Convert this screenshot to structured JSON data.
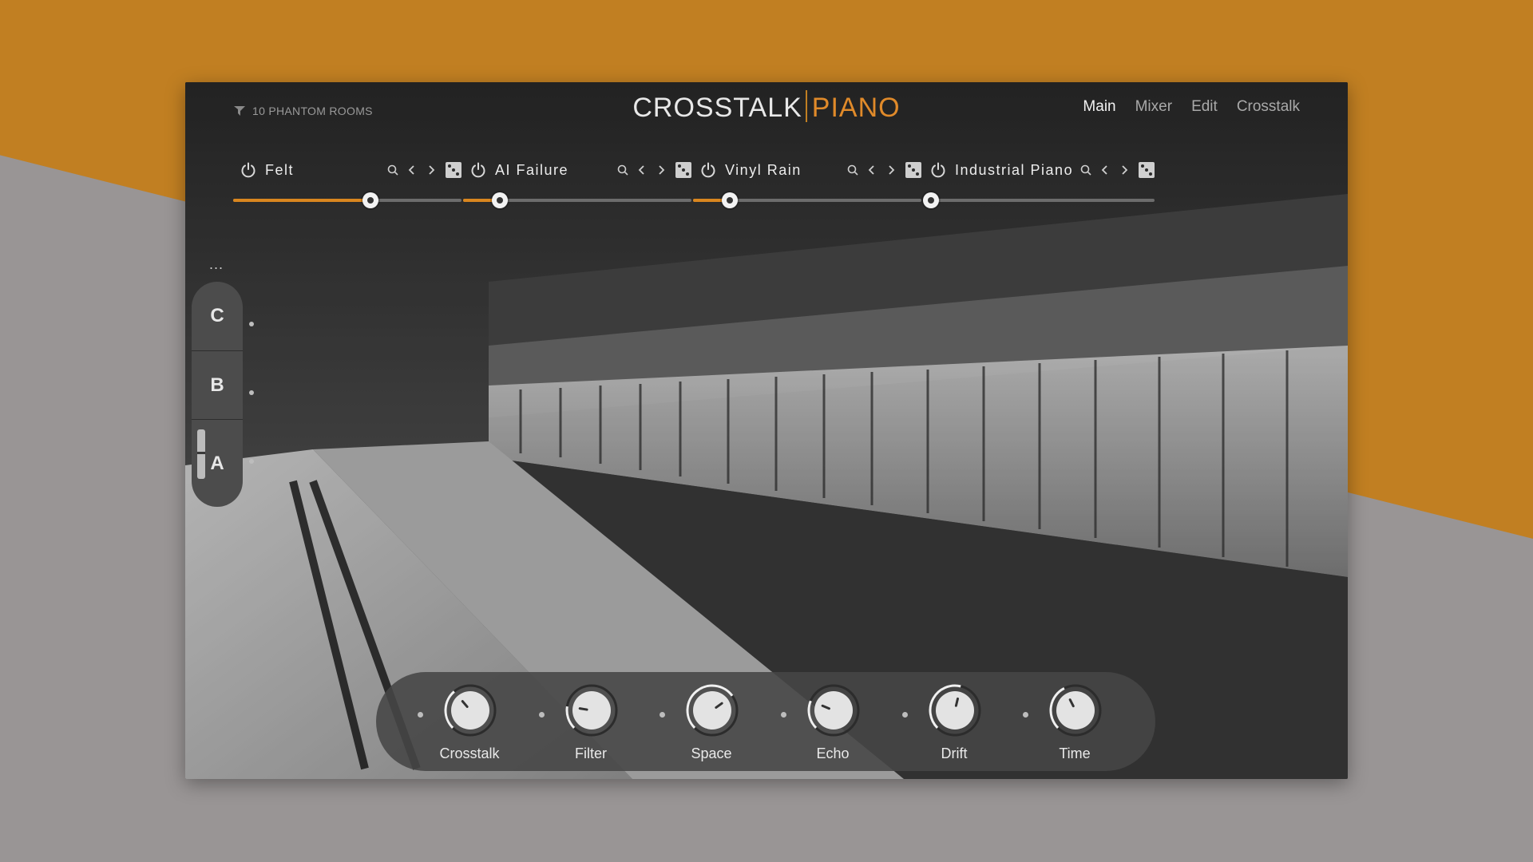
{
  "header": {
    "brand": "10 PHANTOM ROOMS",
    "title_main": "CROSSTALK",
    "title_accent": "PIANO",
    "nav": [
      "Main",
      "Mixer",
      "Edit",
      "Crosstalk"
    ],
    "nav_active": "Main"
  },
  "layers": [
    {
      "name": "Felt",
      "level": 0.6
    },
    {
      "name": "AI Failure",
      "level": 0.16
    },
    {
      "name": "Vinyl Rain",
      "level": 0.16
    },
    {
      "name": "Industrial Piano",
      "level": 0.0
    }
  ],
  "scenes": {
    "more_label": "...",
    "items": [
      "C",
      "B",
      "A"
    ],
    "active": "A"
  },
  "knobs": [
    {
      "label": "Crosstalk",
      "value": 0.35
    },
    {
      "label": "Filter",
      "value": 0.2
    },
    {
      "label": "Space",
      "value": 0.7
    },
    {
      "label": "Echo",
      "value": 0.25
    },
    {
      "label": "Drift",
      "value": 0.55
    },
    {
      "label": "Time",
      "value": 0.4
    }
  ],
  "colors": {
    "accent": "#d9861f",
    "orange_bg": "#c17f22",
    "gray_bg": "#999595"
  }
}
